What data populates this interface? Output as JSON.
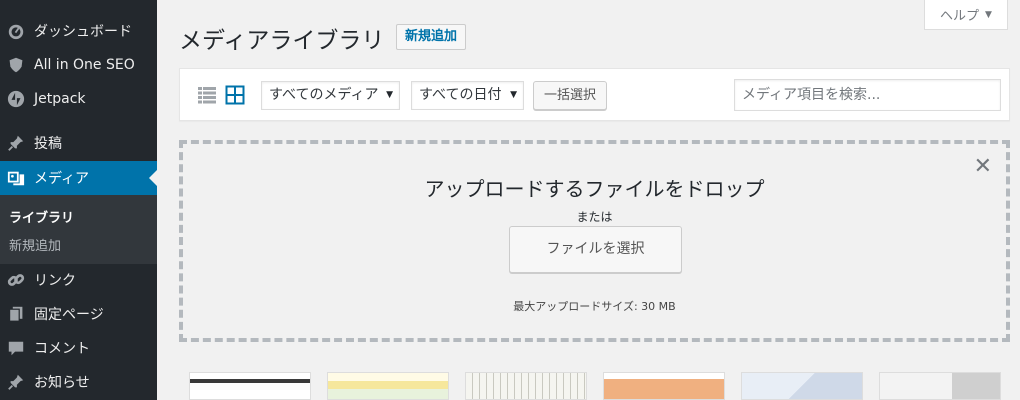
{
  "sidebar": {
    "items": [
      {
        "label": "ダッシュボード",
        "icon": "dashboard-icon"
      },
      {
        "label": "All in One SEO",
        "icon": "shield-icon"
      },
      {
        "label": "Jetpack",
        "icon": "jetpack-icon"
      },
      {
        "label": "投稿",
        "icon": "pin-icon"
      },
      {
        "label": "メディア",
        "icon": "media-icon",
        "active": true
      },
      {
        "label": "リンク",
        "icon": "link-icon"
      },
      {
        "label": "固定ページ",
        "icon": "page-icon"
      },
      {
        "label": "コメント",
        "icon": "comment-icon"
      },
      {
        "label": "お知らせ",
        "icon": "pin-icon"
      }
    ],
    "submenu": [
      {
        "label": "ライブラリ",
        "current": true
      },
      {
        "label": "新規追加"
      }
    ]
  },
  "header": {
    "title": "メディアライブラリ",
    "add_new": "新規追加",
    "help": "ヘルプ"
  },
  "toolbar": {
    "media_filter": "すべてのメディア",
    "date_filter": "すべての日付",
    "bulk_select": "一括選択",
    "search_placeholder": "メディア項目を検索..."
  },
  "uploader": {
    "title": "アップロードするファイルをドロップ",
    "or": "または",
    "select_files": "ファイルを選択",
    "max_size": "最大アップロードサイズ: 30 MB"
  },
  "colors": {
    "sidebar_bg": "#23282d",
    "active_bg": "#0073aa",
    "link": "#0073aa"
  }
}
